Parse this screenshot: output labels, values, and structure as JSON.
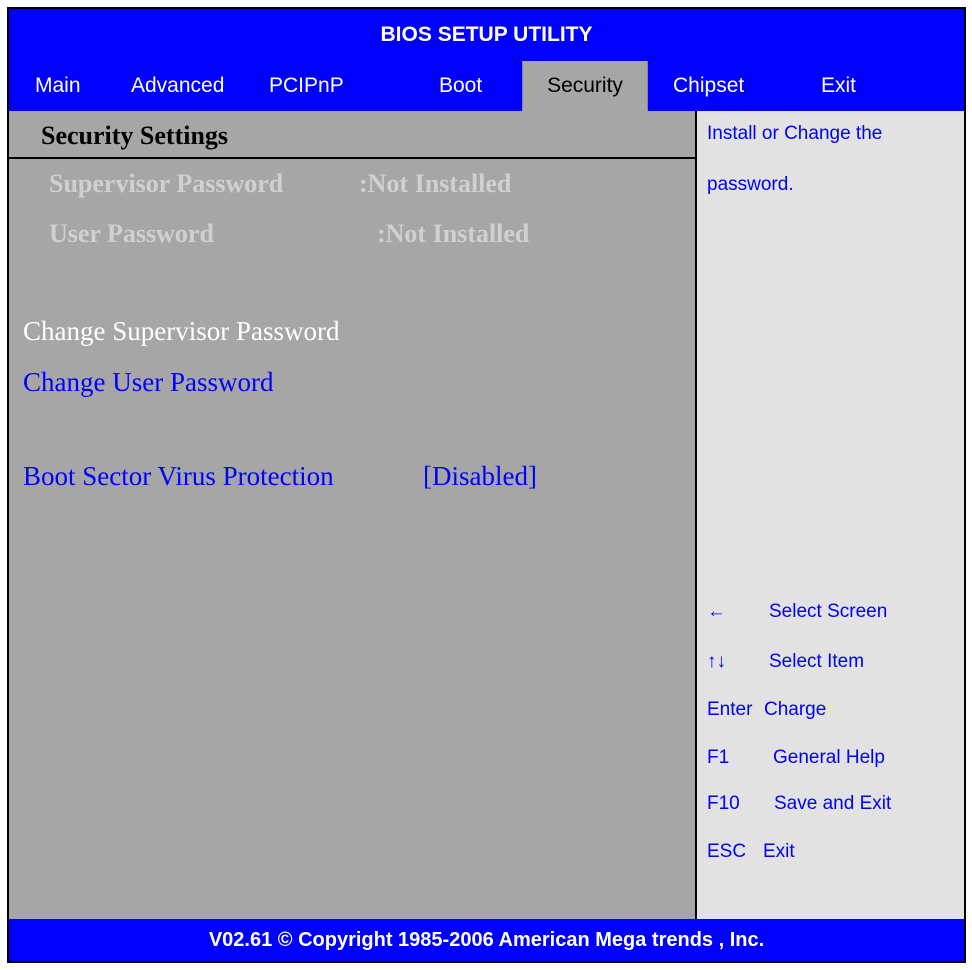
{
  "title": "BIOS SETUP UTILITY",
  "tabs": [
    {
      "label": "Main"
    },
    {
      "label": "Advanced"
    },
    {
      "label": "PCIPnP"
    },
    {
      "label": "Boot"
    },
    {
      "label": "Security"
    },
    {
      "label": "Chipset"
    },
    {
      "label": "Exit"
    }
  ],
  "active_tab": "Security",
  "section_title": "Security Settings",
  "status": {
    "supervisor_label": "Supervisor Password",
    "supervisor_value": ":Not Installed",
    "user_label": "User Password",
    "user_value": ":Not Installed"
  },
  "items": {
    "change_supervisor": "Change Supervisor Password",
    "change_user": "Change User Password",
    "boot_virus_label": "Boot Sector Virus Protection",
    "boot_virus_value": "[Disabled]"
  },
  "help": {
    "line1": "Install or Change the",
    "line2": "password."
  },
  "keys": [
    {
      "key": "←",
      "desc": "Select Screen"
    },
    {
      "key": "↑↓",
      "desc": "Select Item"
    },
    {
      "key": "Enter",
      "desc": "Charge"
    },
    {
      "key": "F1",
      "desc": "General Help"
    },
    {
      "key": "F10",
      "desc": "Save and Exit"
    },
    {
      "key": "ESC",
      "desc": "Exit"
    }
  ],
  "footer": "V02.61 © Copyright 1985-2006 American Mega trends , Inc.",
  "colors": {
    "bios_blue": "#0000ff",
    "panel_grey": "#a6a6a6",
    "help_grey": "#e2e2e2",
    "highlight_white": "#ffffff"
  }
}
